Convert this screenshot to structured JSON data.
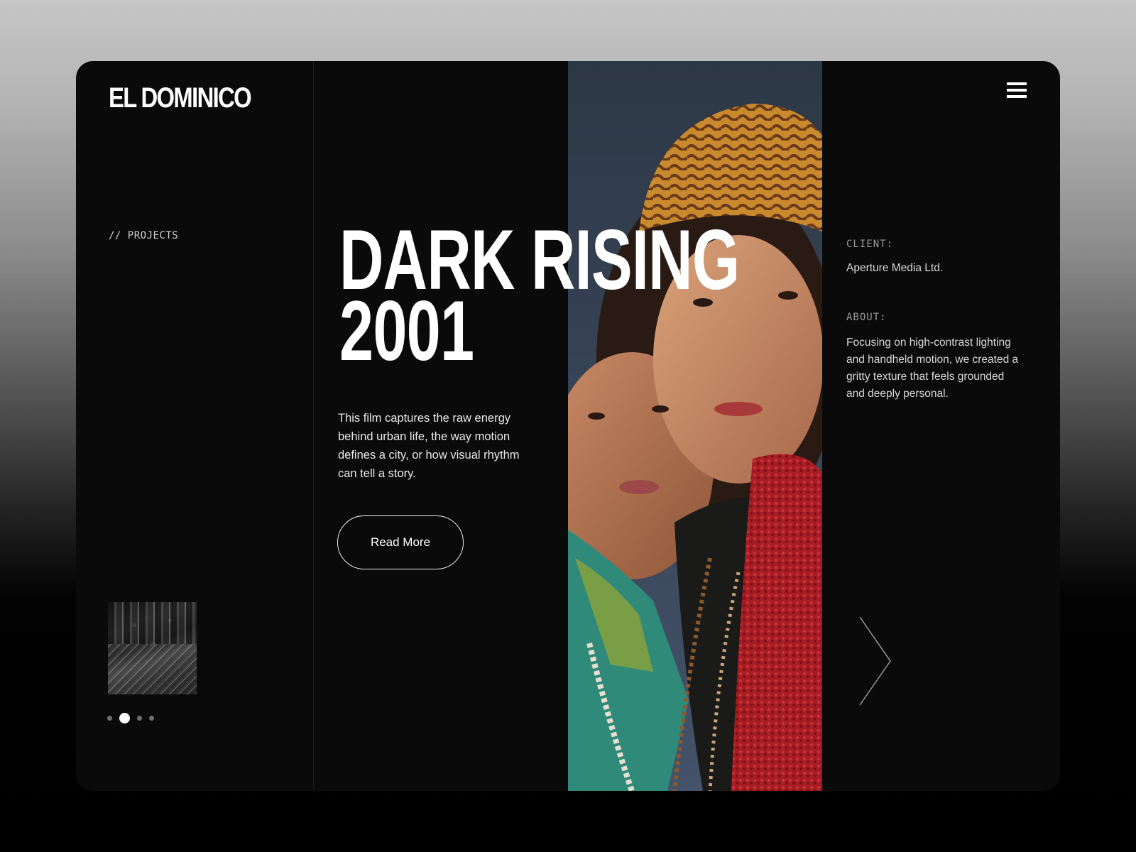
{
  "brand": {
    "logo": "EL DOMINICO"
  },
  "sidebar": {
    "section_label": "// PROJECTS",
    "thumbnail_icon": "city-night-thumbnail",
    "pagination": {
      "count": 4,
      "active_index": 1
    }
  },
  "hero": {
    "title_line1": "DARK RISING",
    "title_line2": "2001",
    "description": "This film captures the raw energy behind urban life, the way motion defines a city, or how visual rhythm can tell a story.",
    "cta_label": "Read More"
  },
  "details": {
    "client_label": "CLIENT:",
    "client_value": "Aperture Media Ltd.",
    "about_label": "ABOUT:",
    "about_value": "Focusing on high-contrast lighting and handheld motion, we created a gritty texture that feels grounded and deeply personal."
  },
  "icons": {
    "menu": "hamburger-menu-icon",
    "next": "chevron-right-icon"
  },
  "colors": {
    "background": "#0a0a0a",
    "text": "#ffffff",
    "muted": "#9a9a9a"
  }
}
